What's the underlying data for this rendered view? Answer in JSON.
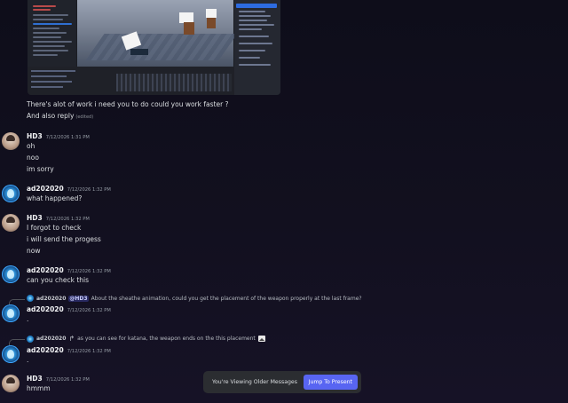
{
  "attachment": {
    "icon": "screenshot-thumbnail"
  },
  "messages_top": {
    "line1": "There's alot of work i need you to do could you work faster ?",
    "line2": "And also reply",
    "edited": "(edited)"
  },
  "groups": [
    {
      "username": "HD3",
      "timestamp": "7/12/2026 1:31 PM",
      "lines": [
        "oh",
        "noo",
        "im sorry"
      ]
    },
    {
      "username": "ad202020",
      "timestamp": "7/12/2026 1:32 PM",
      "lines": [
        "what happened?"
      ]
    },
    {
      "username": "HD3",
      "timestamp": "7/12/2026 1:32 PM",
      "lines": [
        "I forgot to check",
        "i will send the progess",
        "now"
      ]
    },
    {
      "username": "ad202020",
      "timestamp": "7/12/2026 1:32 PM",
      "lines": [
        "can you check this"
      ]
    },
    {
      "reply": {
        "author": "ad202020",
        "mention": "@HD3",
        "text": "About the sheathe animation, could you get the placement of the weapon properly at the last frame?"
      },
      "username": "ad202020",
      "timestamp": "7/12/2026 1:32 PM",
      "lines": [
        "."
      ]
    },
    {
      "reply": {
        "author": "ad202020",
        "text": "as you can see for katana, the weapon ends on the this placement"
      },
      "username": "ad202020",
      "timestamp": "7/12/2026 1:32 PM",
      "lines": [
        "."
      ]
    },
    {
      "username": "HD3",
      "timestamp": "7/12/2026 1:32 PM",
      "lines": [
        "hmmm"
      ]
    }
  ],
  "jumpbar": {
    "text": "You're Viewing Older Messages",
    "button": "Jump To Present"
  },
  "colors": {
    "accent": "#5865f2",
    "background": "#12101f"
  }
}
